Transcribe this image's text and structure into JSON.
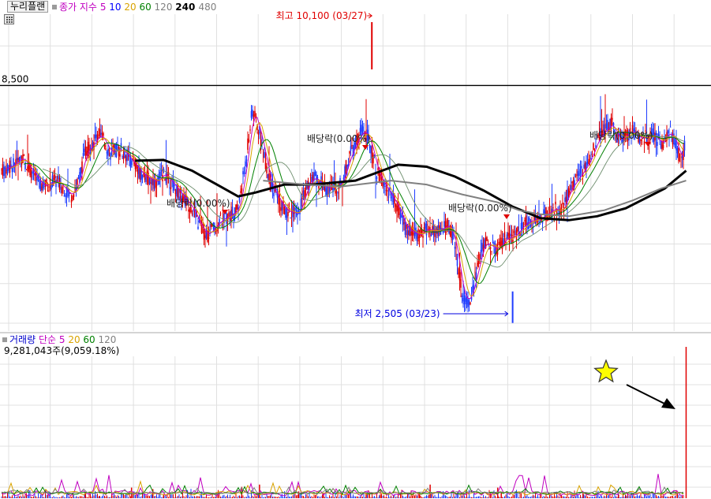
{
  "header": {
    "stock_name": "누리플랜",
    "price_ma_label": "종가 지수",
    "price_ma_periods": [
      "5",
      "10",
      "20",
      "60",
      "120",
      "240",
      "480"
    ],
    "price_ma_colors": [
      "#c000c0",
      "#0000ff",
      "#d9a300",
      "#008000",
      "#808080",
      "#000000",
      "#808080"
    ],
    "volume_label": "거래량",
    "volume_ma_label": "단순",
    "volume_ma_periods": [
      "5",
      "20",
      "60",
      "120"
    ],
    "volume_ma_colors": [
      "#c000c0",
      "#d9a300",
      "#008000",
      "#808080"
    ],
    "volume_readout": "9,281,043주(9,059.18%)"
  },
  "chart_data": [
    {
      "type": "candlestick",
      "title": "",
      "y_range": [
        2300,
        10300
      ],
      "reference_line": {
        "value": 8500,
        "label": "8,500"
      },
      "annotations": [
        {
          "text": "최고 10,100 (03/27)",
          "value": 10100,
          "kind": "high",
          "color": "#e00000"
        },
        {
          "text": "최저 2,505 (03/23)",
          "value": 2505,
          "kind": "low",
          "color": "#0000e0"
        },
        {
          "text": "배당락(0.00%)",
          "kind": "ex-dividend"
        },
        {
          "text": "배당락(0.00%)",
          "kind": "ex-dividend"
        },
        {
          "text": "배당락(0.00%)",
          "kind": "ex-dividend"
        },
        {
          "text": "배당락(0.00%)",
          "kind": "ex-dividend"
        }
      ],
      "series": [
        {
          "name": "240",
          "color": "#000000",
          "x": [
            0.19,
            0.23,
            0.27,
            0.31,
            0.335,
            0.36,
            0.4,
            0.44,
            0.47,
            0.5,
            0.53,
            0.56,
            0.6,
            0.64,
            0.68,
            0.72,
            0.76,
            0.8,
            0.84,
            0.88,
            0.935,
            0.965
          ],
          "y": [
            6600,
            6620,
            6350,
            5950,
            5700,
            5800,
            6000,
            6000,
            6050,
            6100,
            6300,
            6500,
            6450,
            6200,
            5850,
            5450,
            5150,
            5100,
            5200,
            5400,
            5900,
            6350
          ]
        },
        {
          "name": "480",
          "color": "#808080",
          "x": [
            0.37,
            0.43,
            0.48,
            0.55,
            0.6,
            0.65,
            0.7,
            0.73,
            0.76,
            0.8,
            0.85,
            0.89,
            0.93,
            0.965
          ],
          "y": [
            6100,
            6000,
            5950,
            6100,
            6000,
            5750,
            5550,
            5350,
            5250,
            5200,
            5350,
            5600,
            5900,
            6100
          ]
        }
      ],
      "price_path": {
        "x": [
          0.0,
          0.02,
          0.03,
          0.05,
          0.06,
          0.08,
          0.1,
          0.11,
          0.12,
          0.13,
          0.14,
          0.155,
          0.17,
          0.18,
          0.2,
          0.22,
          0.23,
          0.25,
          0.27,
          0.28,
          0.29,
          0.31,
          0.33,
          0.335,
          0.345,
          0.355,
          0.365,
          0.38,
          0.4,
          0.42,
          0.43,
          0.44,
          0.46,
          0.48,
          0.49,
          0.5,
          0.51,
          0.52,
          0.53,
          0.545,
          0.56,
          0.57,
          0.59,
          0.6,
          0.61,
          0.62,
          0.63,
          0.64,
          0.65,
          0.66,
          0.68,
          0.7,
          0.71,
          0.72,
          0.74,
          0.76,
          0.78,
          0.79,
          0.8,
          0.81,
          0.82,
          0.83,
          0.84,
          0.86,
          0.87,
          0.88,
          0.89,
          0.9,
          0.92,
          0.93,
          0.94,
          0.95,
          0.955,
          0.96,
          0.965
        ],
        "y": [
          6350,
          6500,
          6700,
          6200,
          5950,
          6100,
          5700,
          6050,
          6850,
          7000,
          7300,
          6800,
          6900,
          6700,
          6250,
          6050,
          6300,
          5850,
          5400,
          5000,
          4700,
          5100,
          5300,
          5400,
          6500,
          7900,
          7300,
          6000,
          5350,
          5250,
          5900,
          6200,
          5900,
          6000,
          6650,
          7050,
          7400,
          7100,
          6300,
          5850,
          5400,
          4900,
          4700,
          4900,
          4800,
          4850,
          5000,
          4550,
          3200,
          3050,
          4550,
          4350,
          4650,
          4650,
          5050,
          5150,
          5400,
          5300,
          5850,
          6100,
          6350,
          6650,
          7150,
          7550,
          7100,
          7250,
          7350,
          7150,
          7250,
          7000,
          7350,
          7100,
          6700,
          6600,
          7200
        ]
      },
      "high_marker": {
        "x": 0.523,
        "value": 10100
      },
      "low_marker": {
        "x": 0.721,
        "value": 2505
      }
    },
    {
      "type": "bar",
      "title": "",
      "series": [
        {
          "name": "거래량",
          "color": "#e00000",
          "x": [
            0.12,
            0.14,
            0.185,
            0.215,
            0.23,
            0.34,
            0.365,
            0.42,
            0.455,
            0.515,
            0.535,
            0.59,
            0.605,
            0.7,
            0.705,
            0.82,
            0.87,
            0.88,
            0.965
          ],
          "values": [
            0.04,
            0.015,
            0.07,
            0.06,
            0.02,
            0.075,
            0.09,
            0.045,
            0.03,
            0.04,
            0.02,
            0.035,
            0.09,
            0.07,
            0.035,
            0.04,
            0.025,
            0.02,
            1.0
          ]
        }
      ],
      "decoration": {
        "star": true,
        "arrow": true
      }
    }
  ]
}
